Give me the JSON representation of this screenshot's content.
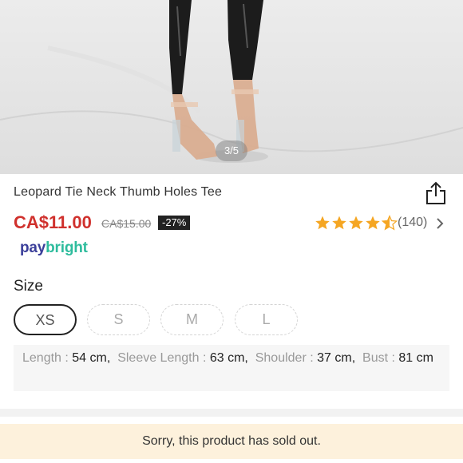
{
  "gallery": {
    "counter": "3/5"
  },
  "product": {
    "title": "Leopard Tie Neck Thumb Holes Tee",
    "price": "CA$11.00",
    "original_price": "CA$15.00",
    "discount": "-27%",
    "rating": 4.5,
    "review_count": "(140)"
  },
  "payment": {
    "brand_a": "pay",
    "brand_b": "bright",
    "brand_colors": [
      "#3b3f9a",
      "#2ebc9d"
    ]
  },
  "size": {
    "label": "Size",
    "options": [
      "XS",
      "S",
      "M",
      "L"
    ],
    "selected": "XS"
  },
  "measurements": {
    "length_key": "Length : ",
    "length_val": "54 cm,",
    "sleeve_key": "Sleeve Length : ",
    "sleeve_val": "63 cm,",
    "shoulder_key": "Shoulder : ",
    "shoulder_val": "37 cm,",
    "bust_key": "Bust : ",
    "bust_val": "81 cm"
  },
  "notice": {
    "sold_out": "Sorry, this product has sold out."
  },
  "colors": {
    "price": "#d0312d",
    "star": "#f5a623",
    "notice_bg": "#fdf1dc"
  },
  "icons": {
    "share": "share-icon",
    "chevron": "chevron-right-icon",
    "star": "star-icon"
  }
}
